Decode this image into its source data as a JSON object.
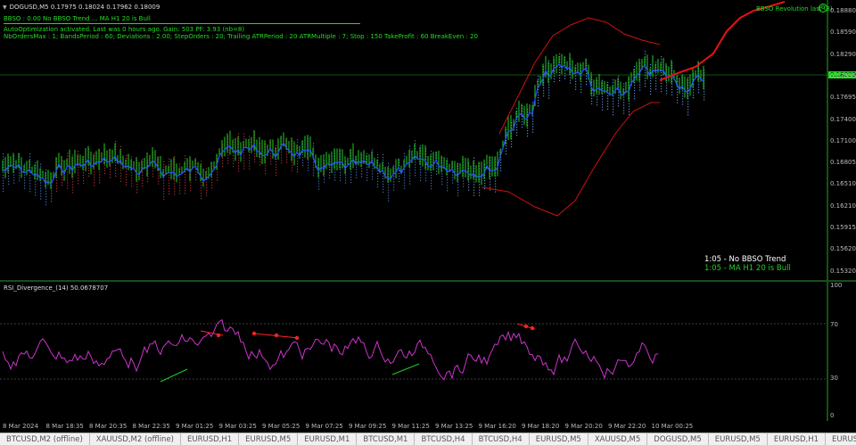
{
  "window": {
    "symbol_line": "DOGUSD,M5  0.17975 0.18024 0.17962 0.18009",
    "bbso_line": "BBSO : 0.00  No BBSO Trend ... MA H1 20 is Bull",
    "auto_line": "AutoOptimization activated. Last was 0 hours ago.   Gain: 503 PF: 3.93 (nb=8)",
    "params_line": "NbOrdersMax : 1; BandsPeriod : 60; Deviations : 2.00; StepOrders : 20; Trailing ATRPeriod : 20 ATRMultiple : 7; Stop : 150 TakeProfit : 60 BreakEven : 20",
    "indicator_name": "BBSO Revolution last (3)",
    "current_price": "0.18009"
  },
  "price_axis": [
    "0.18880",
    "0.18590",
    "0.18290",
    "0.17995",
    "0.17695",
    "0.17400",
    "0.17100",
    "0.16805",
    "0.16510",
    "0.16210",
    "0.15915",
    "0.15620",
    "0.15320"
  ],
  "trend": {
    "line1": "1:05  -  No BBSO Trend",
    "line2": "1:05  -  MA H1 20 is Bull"
  },
  "rsi": {
    "title": "RSI_Divergence_(14) 50.0678707",
    "axis": [
      "100",
      "70",
      "30",
      "0"
    ]
  },
  "time_axis": [
    "8 Mar 2024",
    "8 Mar 18:35",
    "8 Mar 20:35",
    "8 Mar 22:35",
    "9 Mar 01:25",
    "9 Mar 03:25",
    "9 Mar 05:25",
    "9 Mar 07:25",
    "9 Mar 09:25",
    "9 Mar 11:25",
    "9 Mar 13:25",
    "9 Mar 16:20",
    "9 Mar 18:20",
    "9 Mar 20:20",
    "9 Mar 22:20",
    "10 Mar 00:25"
  ],
  "tabs": [
    "BTCUSD,M2 (offline)",
    "XAUUSD,M2 (offline)",
    "EURUSD,H1",
    "EURUSD,M5",
    "EURUSD,M1",
    "BTCUSD,M1",
    "BTCUSD,H4",
    "BTCUSD,H4",
    "EURUSD,M5",
    "XAUUSD,M5",
    "DOGUSD,M5",
    "EURUSD,M5",
    "EURUSD,H1",
    "EURUSD,M5",
    "BTCUSD,M5",
    "EURUSD,M5",
    "DOGUSD,M5"
  ],
  "active_tab_index": 16,
  "colors": {
    "bull": "#22cc22",
    "band": "#cc1111",
    "ma": "#2255ff",
    "rsi": "#cc33cc",
    "accent": "#22dd22"
  }
}
